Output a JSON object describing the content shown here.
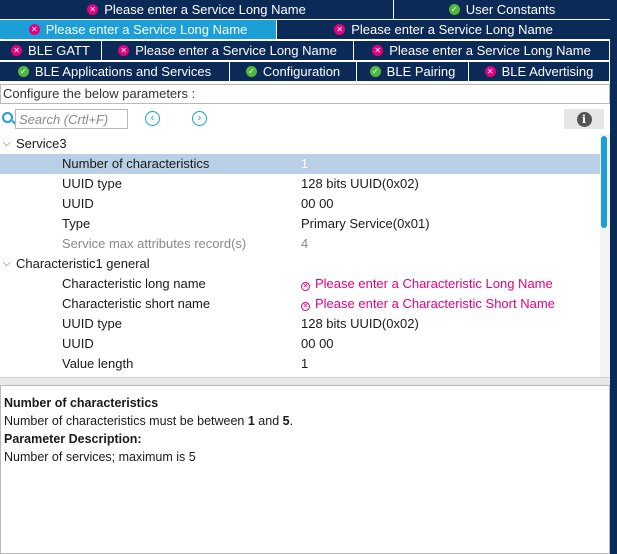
{
  "colors": {
    "tab_bg": "#0b2a57",
    "tab_active_bg": "#1c9fd6",
    "error": "#e6007e",
    "ok": "#52b83c",
    "selected_row": "#b8cfe6"
  },
  "tabs": {
    "row1": [
      {
        "label": "Please enter a Service Long Name",
        "icon": "error-icon",
        "active": false
      },
      {
        "label": "User Constants",
        "icon": "check-icon",
        "active": false
      }
    ],
    "row2": [
      {
        "label": "Please enter a Service Long Name",
        "icon": "error-icon",
        "active": true
      },
      {
        "label": "Please enter a Service Long Name",
        "icon": "error-icon",
        "active": false
      }
    ],
    "row3": [
      {
        "label": "BLE GATT",
        "icon": "error-icon",
        "active": false
      },
      {
        "label": "Please enter a Service Long Name",
        "icon": "error-icon",
        "active": false
      },
      {
        "label": "Please enter a Service Long Name",
        "icon": "error-icon",
        "active": false
      }
    ],
    "row4": [
      {
        "label": "BLE Applications and Services",
        "icon": "check-icon",
        "active": false
      },
      {
        "label": "Configuration",
        "icon": "check-icon",
        "active": false
      },
      {
        "label": "BLE Pairing",
        "icon": "check-icon",
        "active": false
      },
      {
        "label": "BLE Advertising",
        "icon": "error-icon",
        "active": false
      }
    ]
  },
  "header": {
    "text": "Configure the below parameters :"
  },
  "search": {
    "placeholder": "Search (Crtl+F)",
    "prev_icon": "chevron-left-icon",
    "next_icon": "chevron-right-icon",
    "info_icon": "info-icon"
  },
  "tree": {
    "service3": {
      "label": "Service3",
      "params": [
        {
          "name": "Number of characteristics",
          "value": "1"
        },
        {
          "name": "UUID type",
          "value": "128 bits UUID(0x02)"
        },
        {
          "name": "UUID",
          "value": "00 00"
        },
        {
          "name": "Type",
          "value": "Primary Service(0x01)"
        },
        {
          "name": "Service max attributes record(s)",
          "value": "4"
        }
      ]
    },
    "char1": {
      "label": "Characteristic1 general",
      "params": [
        {
          "name": "Characteristic long name",
          "value": "Please enter a Characteristic Long Name"
        },
        {
          "name": "Characteristic short name",
          "value": "Please enter a Characteristic Short Name"
        },
        {
          "name": "UUID type",
          "value": "128 bits UUID(0x02)"
        },
        {
          "name": "UUID",
          "value": "00 00"
        },
        {
          "name": "Value length",
          "value": "1"
        }
      ]
    }
  },
  "description": {
    "title": "Number of characteristics",
    "line_prefix": "Number of characteristics must be between ",
    "min": "1",
    "and": " and ",
    "max": "5",
    "end": ".",
    "param_heading": "Parameter Description:",
    "param_text": "Number of services; maximum is 5"
  }
}
